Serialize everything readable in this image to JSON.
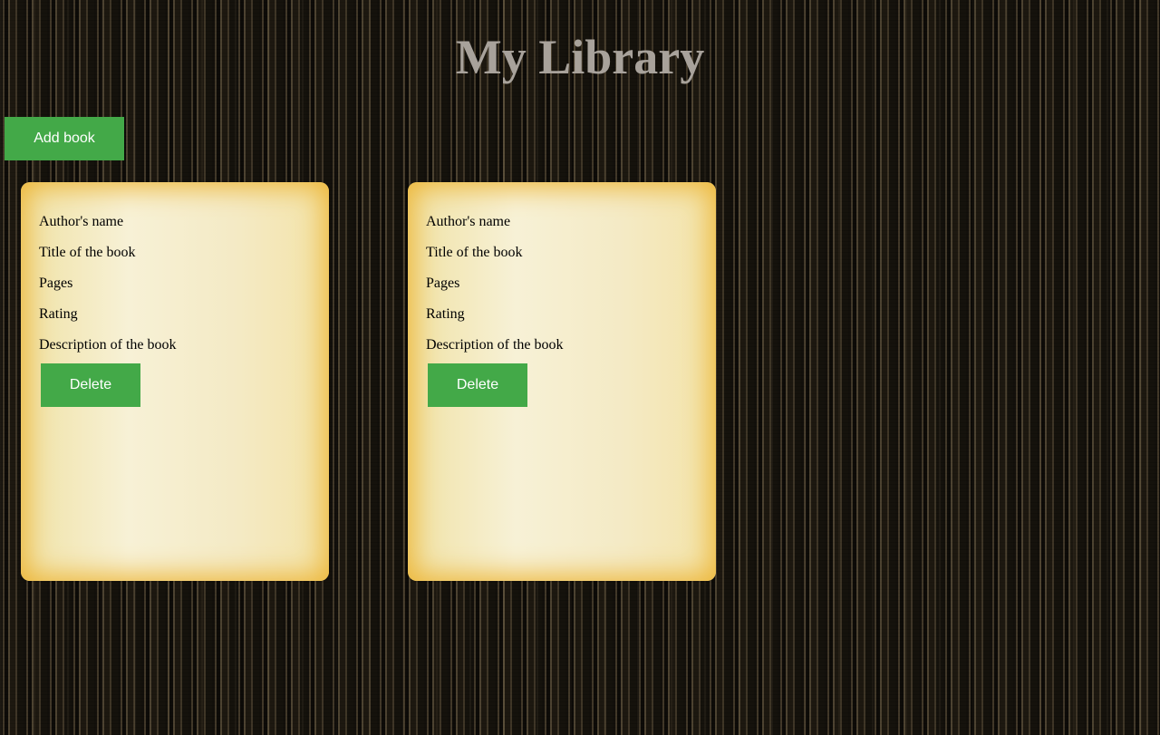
{
  "header": {
    "title": "My Library"
  },
  "toolbar": {
    "add_label": "Add book"
  },
  "books": [
    {
      "author": "Author's name",
      "title": "Title of the book",
      "pages": "Pages",
      "rating": "Rating",
      "description": "Description of the book",
      "delete_label": "Delete"
    },
    {
      "author": "Author's name",
      "title": "Title of the book",
      "pages": "Pages",
      "rating": "Rating",
      "description": "Description of the book",
      "delete_label": "Delete"
    }
  ],
  "colors": {
    "button": "#43a948",
    "card_edge": "#edb73a",
    "title": "#a8a29b"
  }
}
